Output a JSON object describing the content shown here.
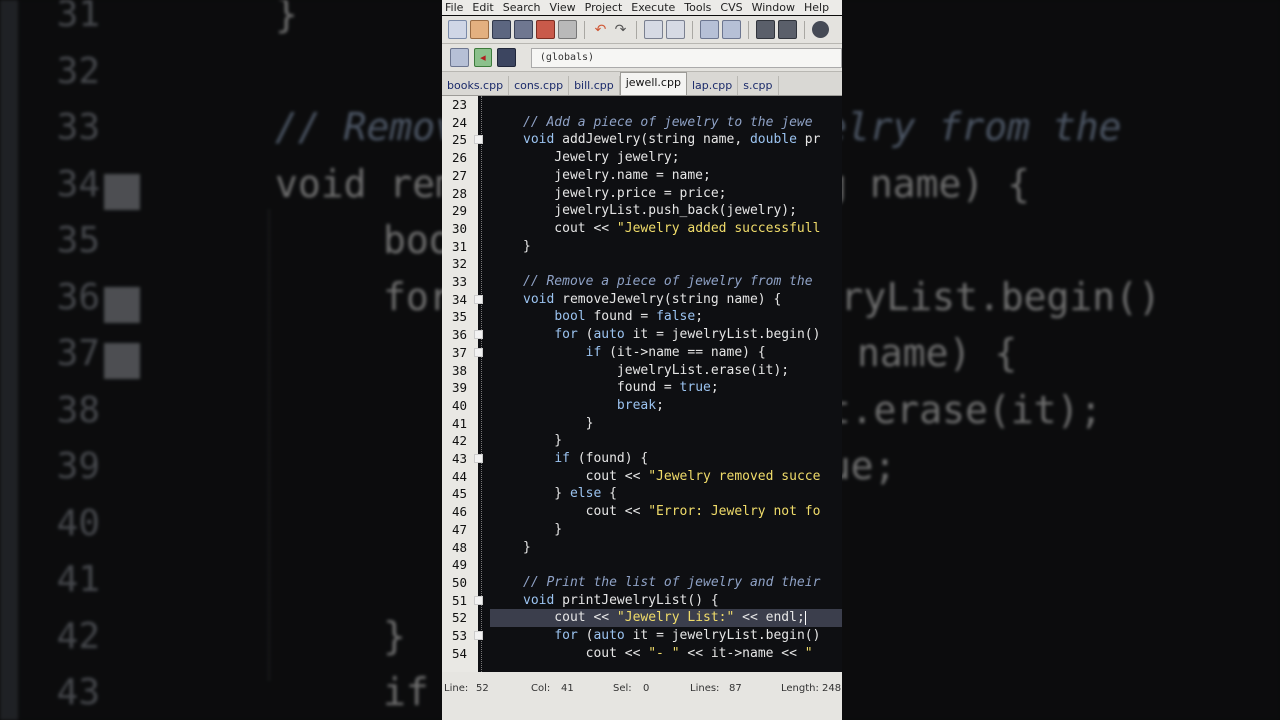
{
  "background": {
    "line_numbers": [
      "31",
      "32",
      "33",
      "34",
      "35",
      "36",
      "37",
      "38",
      "39",
      "40",
      "41",
      "42",
      "43"
    ],
    "code_lines": [
      {
        "text": "}",
        "cls": "",
        "row": 0,
        "indent": 0
      },
      {
        "text": "// Remove a piece of jewelry from the",
        "cls": "comment",
        "row": 2,
        "indent": 0
      },
      {
        "text": "void removeJewelry(string name) {",
        "cls": "",
        "row": 3,
        "indent": 0
      },
      {
        "text": "bool found = false;",
        "cls": "",
        "row": 4,
        "indent": 1
      },
      {
        "text": "for (auto it = jewelryList.begin()",
        "cls": "",
        "row": 5,
        "indent": 1
      },
      {
        "text": "if (it->name == name) {",
        "cls": "",
        "row": 6,
        "indent": 2
      },
      {
        "text": "jewelryList.erase(it);",
        "cls": "",
        "row": 7,
        "indent": 3
      },
      {
        "text": "found = true;",
        "cls": "",
        "row": 8,
        "indent": 3
      },
      {
        "text": "}",
        "cls": "",
        "row": 11,
        "indent": 1
      },
      {
        "text": "if (found) {",
        "cls": "",
        "row": 12,
        "indent": 1
      }
    ]
  },
  "menu": [
    "File",
    "Edit",
    "Search",
    "View",
    "Project",
    "Execute",
    "Tools",
    "CVS",
    "Window",
    "Help"
  ],
  "scope_selector": "(globals)",
  "tabs": [
    "books.cpp",
    "cons.cpp",
    "bill.cpp",
    "jewell.cpp",
    "lap.cpp",
    "s.cpp"
  ],
  "active_tab": "jewell.cpp",
  "editor": {
    "lines": [
      {
        "n": "23",
        "fold": false,
        "html": ""
      },
      {
        "n": "24",
        "fold": false,
        "html": "<span class=\"c\">// Add a piece of jewelry to the jewe</span>"
      },
      {
        "n": "25",
        "fold": true,
        "html": "<span class=\"k\">void</span> addJewelry(string name, <span class=\"k\">double</span> pr"
      },
      {
        "n": "26",
        "fold": false,
        "html": "    Jewelry jewelry;"
      },
      {
        "n": "27",
        "fold": false,
        "html": "    jewelry.name = name;"
      },
      {
        "n": "28",
        "fold": false,
        "html": "    jewelry.price = price;"
      },
      {
        "n": "29",
        "fold": false,
        "html": "    jewelryList.push_back(jewelry);"
      },
      {
        "n": "30",
        "fold": false,
        "html": "    cout &lt;&lt; <span class=\"s\">\"Jewelry added successfull</span>"
      },
      {
        "n": "31",
        "fold": false,
        "html": "}"
      },
      {
        "n": "32",
        "fold": false,
        "html": ""
      },
      {
        "n": "33",
        "fold": false,
        "html": "<span class=\"c\">// Remove a piece of jewelry from the</span>"
      },
      {
        "n": "34",
        "fold": true,
        "html": "<span class=\"k\">void</span> removeJewelry(string name) {"
      },
      {
        "n": "35",
        "fold": false,
        "html": "    <span class=\"k\">bool</span> found = <span class=\"k\">false</span>;"
      },
      {
        "n": "36",
        "fold": true,
        "html": "    <span class=\"k\">for</span> (<span class=\"k\">auto</span> it = jewelryList.begin()"
      },
      {
        "n": "37",
        "fold": true,
        "html": "        <span class=\"k\">if</span> (it-&gt;name == name) {"
      },
      {
        "n": "38",
        "fold": false,
        "html": "            jewelryList.erase(it);"
      },
      {
        "n": "39",
        "fold": false,
        "html": "            found = <span class=\"k\">true</span>;"
      },
      {
        "n": "40",
        "fold": false,
        "html": "            <span class=\"k\">break</span>;"
      },
      {
        "n": "41",
        "fold": false,
        "html": "        }"
      },
      {
        "n": "42",
        "fold": false,
        "html": "    }"
      },
      {
        "n": "43",
        "fold": true,
        "html": "    <span class=\"k\">if</span> (found) {"
      },
      {
        "n": "44",
        "fold": false,
        "html": "        cout &lt;&lt; <span class=\"s\">\"Jewelry removed succe</span>"
      },
      {
        "n": "45",
        "fold": false,
        "html": "    } <span class=\"k\">else</span> {"
      },
      {
        "n": "46",
        "fold": false,
        "html": "        cout &lt;&lt; <span class=\"s\">\"Error: Jewelry not fo</span>"
      },
      {
        "n": "47",
        "fold": false,
        "html": "    }"
      },
      {
        "n": "48",
        "fold": false,
        "html": "}"
      },
      {
        "n": "49",
        "fold": false,
        "html": ""
      },
      {
        "n": "50",
        "fold": false,
        "html": "<span class=\"c\">// Print the list of jewelry and their</span>"
      },
      {
        "n": "51",
        "fold": true,
        "html": "<span class=\"k\">void</span> printJewelryList() {"
      },
      {
        "n": "52",
        "fold": false,
        "html": "    cout &lt;&lt; <span class=\"s\">\"Jewelry List:\"</span> &lt;&lt; endl;<span class=\"caret\"></span>",
        "highlight": true
      },
      {
        "n": "53",
        "fold": true,
        "html": "    <span class=\"k\">for</span> (<span class=\"k\">auto</span> it = jewelryList.begin()"
      },
      {
        "n": "54",
        "fold": false,
        "html": "        cout &lt;&lt; <span class=\"s\">\"- \"</span> &lt;&lt; it-&gt;name &lt;&lt; <span class=\"s\">\"</span>"
      }
    ]
  },
  "status": {
    "line_label": "Line:",
    "line_value": "52",
    "col_label": "Col:",
    "col_value": "41",
    "sel_label": "Sel:",
    "sel_value": "0",
    "lines_label": "Lines:",
    "lines_value": "87",
    "length_label": "Length:",
    "length_value": "248"
  },
  "colors": {
    "keyword": "#9bc3f0",
    "comment": "#8fa2c6",
    "string": "#f0dc6a",
    "editor_bg": "#0e0f12",
    "current_line": "#3b3e4c"
  }
}
